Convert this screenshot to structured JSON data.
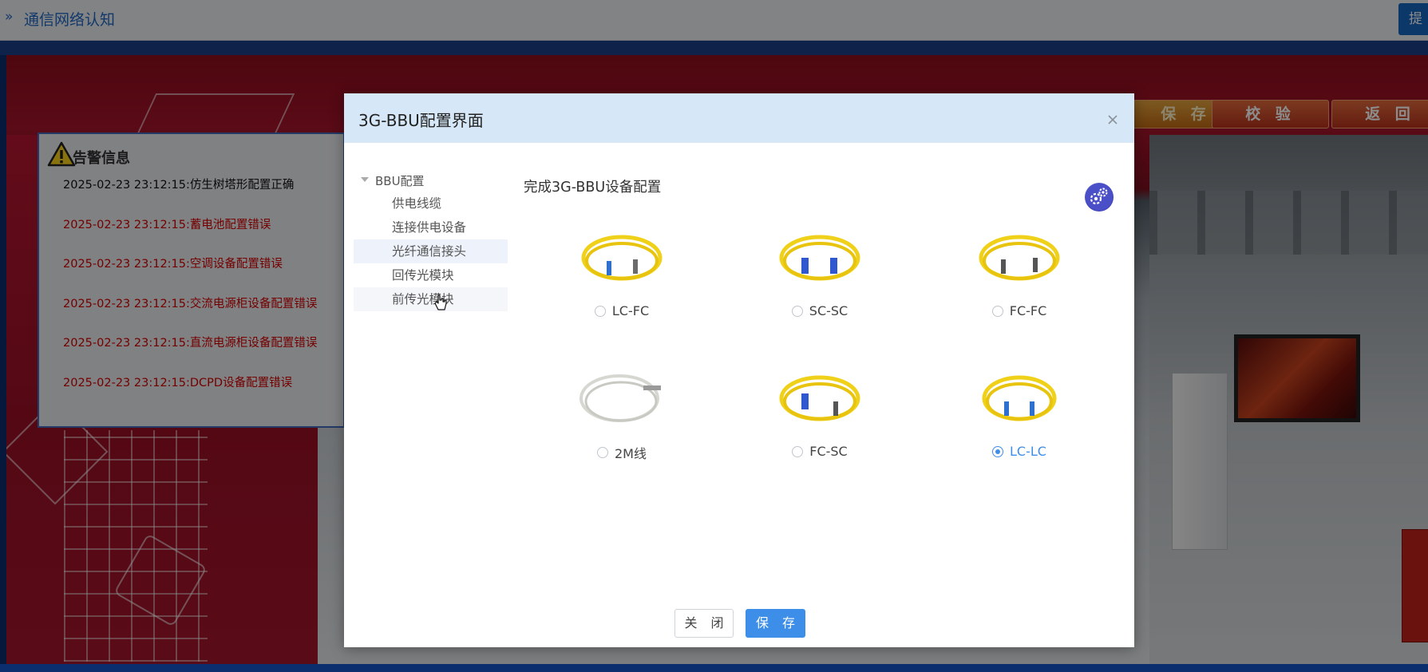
{
  "topbar": {
    "crumb_icon": "»",
    "title": "通信网络认知",
    "corner_button": "提"
  },
  "scene": {
    "buttons": {
      "save": "保 存",
      "check": "校 验",
      "back": "返 回"
    }
  },
  "alarm": {
    "title": "告警信息",
    "items": [
      {
        "text": "2025-02-23 23:12:15:仿生树塔形配置正确",
        "status": "ok"
      },
      {
        "text": "2025-02-23 23:12:15:蓄电池配置错误",
        "status": "error"
      },
      {
        "text": "2025-02-23 23:12:15:空调设备配置错误",
        "status": "error"
      },
      {
        "text": "2025-02-23 23:12:15:交流电源柜设备配置错误",
        "status": "error"
      },
      {
        "text": "2025-02-23 23:12:15:直流电源柜设备配置错误",
        "status": "error"
      },
      {
        "text": "2025-02-23 23:12:15:DCPD设备配置错误",
        "status": "error"
      }
    ]
  },
  "dialog": {
    "title": "3G-BBU配置界面",
    "tree": {
      "root": "BBU配置",
      "items": [
        "供电线缆",
        "连接供电设备",
        "光纤通信接头",
        "回传光模块",
        "前传光模块"
      ]
    },
    "content_title": "完成3G-BBU设备配置",
    "options": [
      {
        "label": "LC-FC",
        "checked": false
      },
      {
        "label": "SC-SC",
        "checked": false
      },
      {
        "label": "FC-FC",
        "checked": false
      },
      {
        "label": "2M线",
        "checked": false
      },
      {
        "label": "FC-SC",
        "checked": false
      },
      {
        "label": "LC-LC",
        "checked": true
      }
    ],
    "buttons": {
      "close": "关 闭",
      "save": "保 存"
    }
  },
  "colors": {
    "accent": "#3d8ee8",
    "error": "#d40000",
    "header": "#d6e8f7"
  }
}
